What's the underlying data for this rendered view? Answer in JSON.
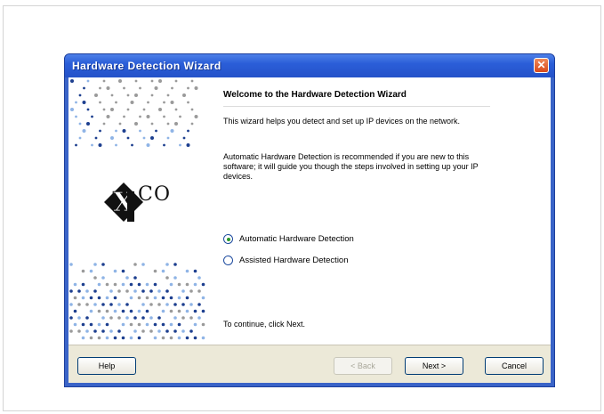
{
  "window": {
    "title": "Hardware Detection Wizard",
    "close_symbol": "✕"
  },
  "side_panel": {
    "logo_text": "XICO"
  },
  "content": {
    "heading": "Welcome to the Hardware Detection Wizard",
    "paragraph1": "This wizard helps you detect and set up IP devices on the network.",
    "paragraph2": "Automatic Hardware Detection is recommended if you are new to this software; it will guide you though the steps involved in setting up your IP devices.",
    "options": [
      {
        "label": "Automatic Hardware Detection",
        "checked": true
      },
      {
        "label": "Assisted Hardware Detection",
        "checked": false
      }
    ],
    "continue_text": "To continue, click Next."
  },
  "buttons": {
    "help": "Help",
    "back": "< Back",
    "next": "Next >",
    "cancel": "Cancel"
  },
  "colors": {
    "titlebar": "#2452c9",
    "dots_blue": "#1d3f8f",
    "dots_light": "#8fb4e6",
    "dots_gray": "#9a9a9a"
  },
  "icons": {
    "close": "close-icon",
    "logo": "xico-logo-icon"
  }
}
